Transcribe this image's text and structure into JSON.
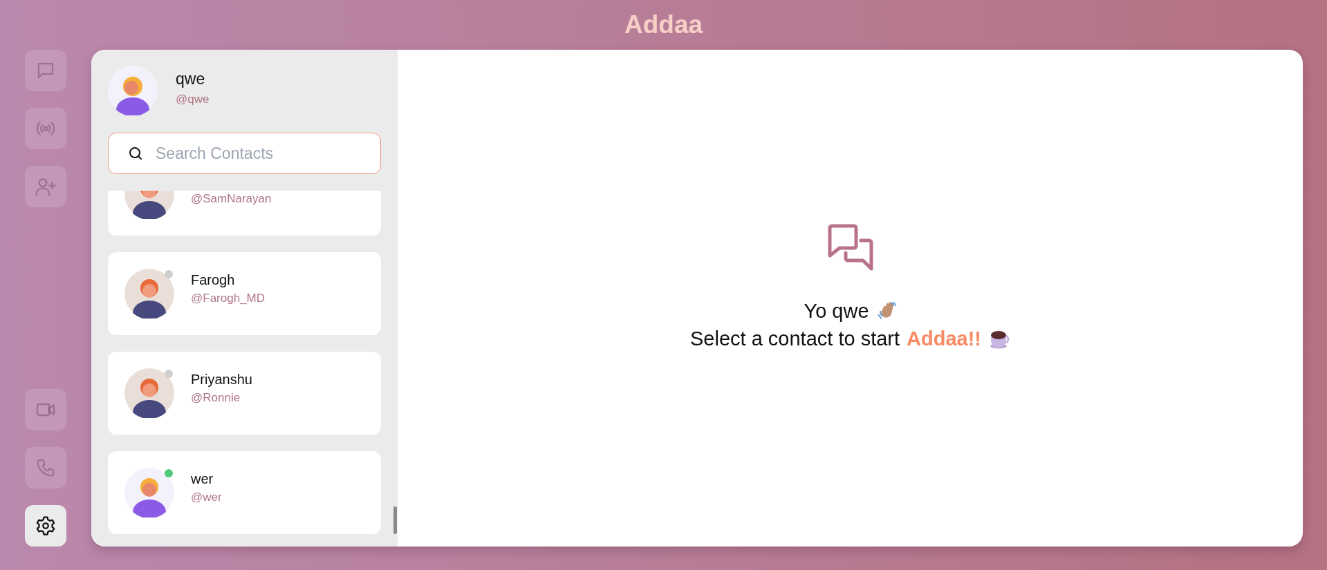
{
  "app_title": "Addaa",
  "nav": [
    {
      "selected": false
    },
    {
      "selected": false
    },
    {
      "selected": false
    },
    {
      "selected": false
    },
    {
      "selected": false
    },
    {
      "selected": true
    }
  ],
  "profile": {
    "name": "qwe",
    "handle": "@qwe"
  },
  "search": {
    "placeholder": "Search Contacts"
  },
  "contacts": [
    {
      "handle": "@SamNarayan",
      "kind": "navy"
    },
    {
      "name": "Farogh",
      "handle": "@Farogh_MD",
      "kind": "navy",
      "online": false
    },
    {
      "name": "Priyanshu",
      "handle": "@Ronnie",
      "kind": "navy",
      "online": false
    },
    {
      "name": "wer",
      "handle": "@wer",
      "kind": "violet",
      "online": true
    }
  ],
  "empty_state": {
    "greeting": "Yo qwe",
    "prompt": "Select a contact to start",
    "highlight": "Addaa!!"
  }
}
